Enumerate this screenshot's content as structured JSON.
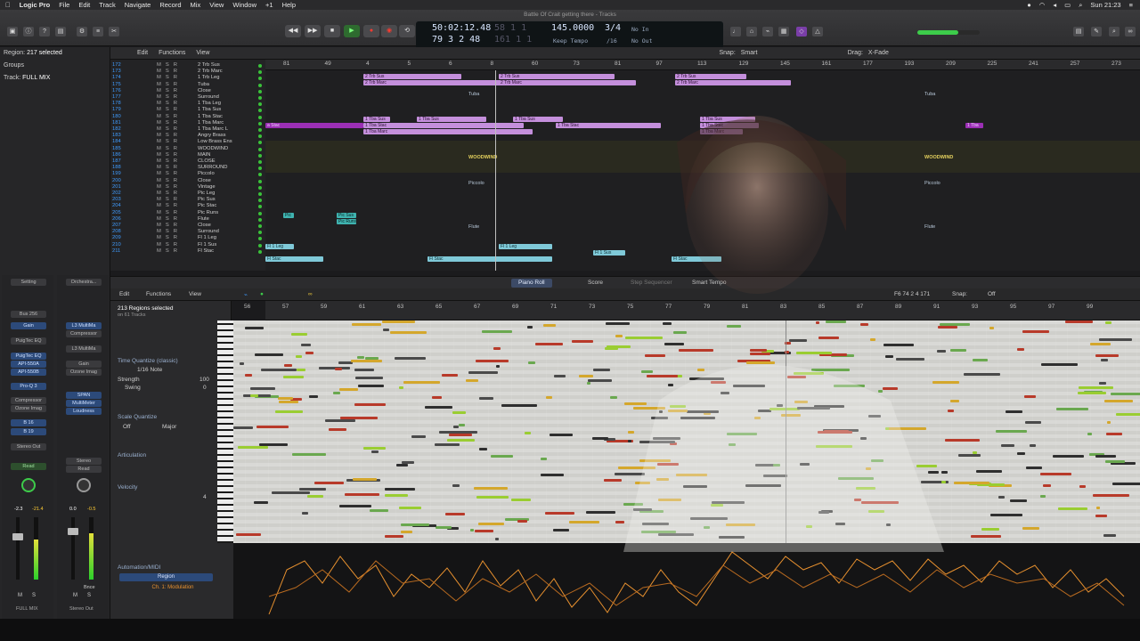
{
  "menubar": {
    "app": "Logic Pro",
    "items": [
      "File",
      "Edit",
      "Track",
      "Navigate",
      "Record",
      "Mix",
      "View",
      "Window",
      "+1",
      "Help"
    ],
    "clock": "Sun 21:23"
  },
  "window_title": "Battle Of Crait getting there - Tracks",
  "lcd": {
    "position_time": "50:02:12.48",
    "time_right": "58 1 1",
    "position_bars": "79 3 2 48",
    "bars_right": "161 1 1",
    "tempo": "145.0000",
    "tempo_mode": "Keep Tempo",
    "time_sig": "3/4",
    "division": "/16",
    "in": "No In",
    "out": "No Out"
  },
  "inspector": {
    "region_label": "Region:",
    "region_value": "217 selected",
    "groups": "Groups",
    "track_label": "Track:",
    "track_value": "FULL MIX",
    "strip_left": {
      "setting": "Setting",
      "bus": "Bus 256",
      "gain": "Gain",
      "plugins": [
        "PuigTec EQ",
        "PuigTec EQ",
        "API-550A",
        "API-550B",
        "Pro-Q 3"
      ],
      "plugin_labels": [
        "Compressor",
        "Ozone Imag"
      ],
      "sends": [
        "B 16",
        "B 19"
      ],
      "output": "Stereo Out",
      "mode": "Read",
      "level_l": "-2.3",
      "level_r": "-21.4",
      "name": "FULL MIX"
    },
    "strip_right": {
      "setting": "Orchestra...",
      "plugins": [
        "L3 MultiMa",
        "SPAN",
        "MultiMeter",
        "Loudness"
      ],
      "plugin_labels": [
        "Compressor",
        "L3 MultiMa",
        "Gain",
        "Ozone Imag"
      ],
      "output": "Stereo",
      "mode": "Read",
      "level_l": "0.0",
      "level_r": "-0.5",
      "bnce": "Bnce",
      "name": "Stereo Out"
    }
  },
  "tracks_toolbar": {
    "edit": "Edit",
    "functions": "Functions",
    "view": "View",
    "snap_label": "Snap:",
    "snap": "Smart",
    "drag_label": "Drag:",
    "drag": "X-Fade"
  },
  "ruler_top": [
    "81",
    "49",
    "4",
    "5",
    "6",
    "8",
    "60",
    "73",
    "81",
    "97",
    "113",
    "129",
    "145",
    "161",
    "177",
    "193",
    "209",
    "225",
    "241",
    "257",
    "273"
  ],
  "tracks": [
    {
      "num": "172",
      "name": "2 Trb Sus"
    },
    {
      "num": "173",
      "name": "2 Trb Marc"
    },
    {
      "num": "174",
      "name": "1 Trb Leg"
    },
    {
      "num": "175",
      "name": "Tuba"
    },
    {
      "num": "176",
      "name": "Close"
    },
    {
      "num": "177",
      "name": "Surround"
    },
    {
      "num": "178",
      "name": "1 Tba Leg"
    },
    {
      "num": "179",
      "name": "1 Tba Sus"
    },
    {
      "num": "180",
      "name": "1 Tba Stac"
    },
    {
      "num": "181",
      "name": "1 Tba Marc"
    },
    {
      "num": "182",
      "name": "1 Tba Marc L"
    },
    {
      "num": "183",
      "name": "Angry Brass"
    },
    {
      "num": "184",
      "name": "Low Brass Ens"
    },
    {
      "num": "185",
      "name": "WOODWIND"
    },
    {
      "num": "186",
      "name": "MAIN"
    },
    {
      "num": "187",
      "name": "CLOSE"
    },
    {
      "num": "188",
      "name": "SURROUND"
    },
    {
      "num": "199",
      "name": "Piccolo"
    },
    {
      "num": "200",
      "name": "Close"
    },
    {
      "num": "201",
      "name": "Vintage"
    },
    {
      "num": "202",
      "name": "Pic Leg"
    },
    {
      "num": "203",
      "name": "Pic Sus"
    },
    {
      "num": "204",
      "name": "Pic Stac"
    },
    {
      "num": "205",
      "name": "Pic Runs"
    },
    {
      "num": "206",
      "name": "Flute"
    },
    {
      "num": "207",
      "name": "Close"
    },
    {
      "num": "208",
      "name": "Surround"
    },
    {
      "num": "209",
      "name": "Fl 1 Leg"
    },
    {
      "num": "210",
      "name": "Fl 1 Sus"
    },
    {
      "num": "211",
      "name": "Fl Stac"
    }
  ],
  "arrange_labels": {
    "tuba": "Tuba",
    "woodwind": "WOODWIND",
    "piccolo": "Piccolo",
    "flute": "Flute",
    "tuba_right": "Tuba",
    "woodwind_right": "WOODWIND",
    "piccolo_right": "Piccolo",
    "flute_right": "Flute"
  },
  "regions": {
    "trb_sus": "2 Trb Sus",
    "trb_marc": "2 Trb Marc",
    "tba_sus": "1 Tba Sus",
    "tba_stac": "1 Tba Stac",
    "tba_marc": "1 Tba Marc",
    "stac": "a Stac",
    "tba": "1 Tba",
    "pic": "Pic",
    "pic_sus": "Pic Sus",
    "pic_runs": "Pic Runs",
    "fl_leg": "Fl 1 Leg",
    "fl_stac": "Fl Stac",
    "fl_sus": "Fl 1 Sus"
  },
  "editor": {
    "tabs": [
      "Piano Roll",
      "Score",
      "Step Sequencer",
      "Smart Tempo"
    ],
    "edit": "Edit",
    "functions": "Functions",
    "view": "View",
    "regions_selected": "213 Regions selected",
    "regions_sub": "on 61 Tracks",
    "time_quantize": "Time Quantize (classic)",
    "note_value": "1/16 Note",
    "strength_label": "Strength",
    "strength": "100",
    "swing_label": "Swing",
    "swing": "0",
    "scale_quantize": "Scale Quantize",
    "scale_off": "Off",
    "scale_major": "Major",
    "articulation": "Articulation",
    "velocity": "Velocity",
    "velocity_val": "4",
    "automation": "Automation/MIDI",
    "region": "Region",
    "modulation": "Ch. 1: Modulation",
    "position_readout": "F6  74 2 4 171",
    "snap_label": "Snap:",
    "snap_value": "Off"
  },
  "editor_ruler": [
    "56",
    "57",
    "59",
    "61",
    "63",
    "65",
    "67",
    "69",
    "71",
    "73",
    "75",
    "77",
    "79",
    "81",
    "83",
    "85",
    "87",
    "89",
    "91",
    "93",
    "95",
    "97",
    "99"
  ],
  "colors": {
    "accent_blue": "#3f9cff",
    "region_purple": "#c48fdc",
    "region_magenta": "#9b2fb5",
    "region_cyan": "#7fc9d8",
    "play_green": "#2e6b2f",
    "automation_orange": "#e8912f"
  }
}
